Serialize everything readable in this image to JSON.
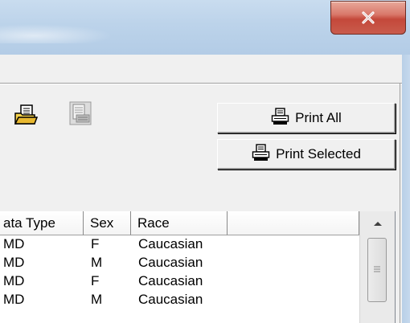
{
  "toolbar": {
    "print_all_label": "Print All",
    "print_selected_label": "Print Selected"
  },
  "icons": {
    "close": "close-icon",
    "open_folder": "open-folder-icon",
    "preview": "print-preview-icon",
    "printer": "printer-icon"
  },
  "list": {
    "columns": [
      "ata Type",
      "Sex",
      "Race",
      ""
    ],
    "rows": [
      {
        "data_type": "MD",
        "sex": "F",
        "race": "Caucasian"
      },
      {
        "data_type": "MD",
        "sex": "M",
        "race": "Caucasian"
      },
      {
        "data_type": "MD",
        "sex": "F",
        "race": "Caucasian"
      },
      {
        "data_type": "MD",
        "sex": "M",
        "race": "Caucasian"
      }
    ]
  },
  "colors": {
    "close_button": "#c4483a",
    "titlebar": "#bcd3ea",
    "face": "#f0f0f0"
  }
}
